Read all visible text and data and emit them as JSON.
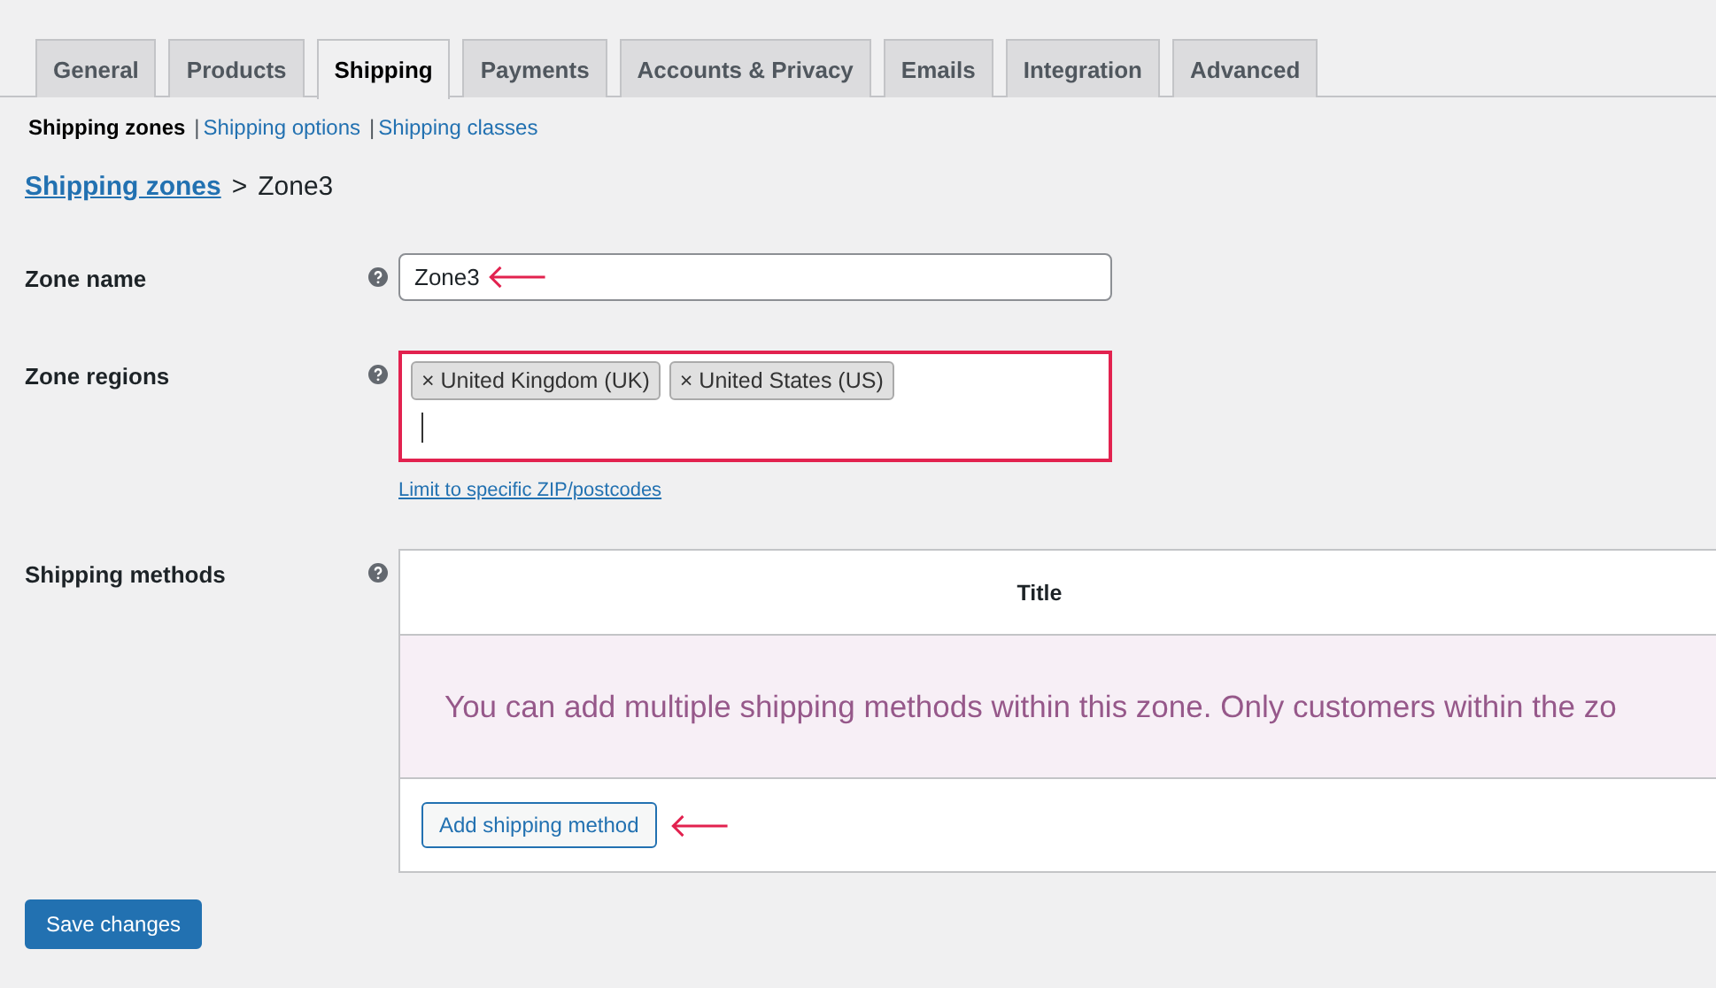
{
  "tabs": [
    {
      "label": "General",
      "selected": false
    },
    {
      "label": "Products",
      "selected": false
    },
    {
      "label": "Shipping",
      "selected": true
    },
    {
      "label": "Payments",
      "selected": false
    },
    {
      "label": "Accounts & Privacy",
      "selected": false
    },
    {
      "label": "Emails",
      "selected": false
    },
    {
      "label": "Integration",
      "selected": false
    },
    {
      "label": "Advanced",
      "selected": false
    }
  ],
  "subnav": [
    {
      "label": "Shipping zones",
      "selected": true
    },
    {
      "label": "Shipping options",
      "selected": false
    },
    {
      "label": "Shipping classes",
      "selected": false
    }
  ],
  "separator": "|",
  "breadcrumb": {
    "link": "Shipping zones",
    "separator": ">",
    "current": "Zone3"
  },
  "zone_name": {
    "label": "Zone name",
    "value": "Zone3"
  },
  "zone_regions": {
    "label": "Zone regions",
    "remove_symbol": "×",
    "tags": [
      "United Kingdom (UK)",
      "United States (US)"
    ],
    "limit_link": "Limit to specific ZIP/postcodes"
  },
  "shipping_methods": {
    "label": "Shipping methods",
    "column": "Title",
    "empty_message": "You can add multiple shipping methods within this zone. Only customers within the zo",
    "add_button": "Add shipping method"
  },
  "save_button": "Save changes"
}
